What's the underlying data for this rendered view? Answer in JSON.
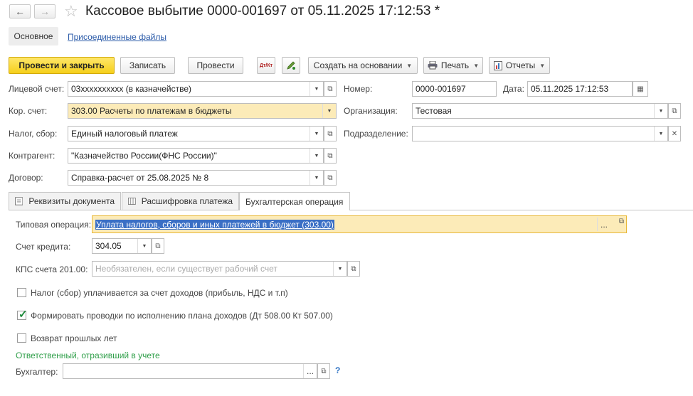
{
  "header": {
    "back_icon": "←",
    "forward_icon": "→",
    "star_icon": "☆",
    "title": "Кассовое выбытие 0000-001697 от 05.11.2025 17:12:53 *"
  },
  "nav_tabs": {
    "main": "Основное",
    "files": "Присоединенные файлы"
  },
  "toolbar": {
    "post_close": "Провести и закрыть",
    "save": "Записать",
    "post": "Провести",
    "dt_kt_icon": "Дт/Кт",
    "create_based": "Создать на основании",
    "print": "Печать",
    "reports": "Отчеты"
  },
  "form": {
    "account_label": "Лицевой счет:",
    "account_value": "03xxxxxxxxxx (в казначействе)",
    "number_label": "Номер:",
    "number_value": "0000-001697",
    "date_label": "Дата:",
    "date_value": "05.11.2025 17:12:53",
    "cor_label": "Кор. счет:",
    "cor_value": "303.00 Расчеты по платежам в бюджеты",
    "org_label": "Организация:",
    "org_value": "Тестовая",
    "tax_label": "Налог, сбор:",
    "tax_value": "Единый налоговый платеж",
    "dept_label": "Подразделение:",
    "dept_value": "",
    "contractor_label": "Контрагент:",
    "contractor_value": "\"Казначейство России(ФНС России)\"",
    "contract_label": "Договор:",
    "contract_value": "Справка-расчет от 25.08.2025 № 8"
  },
  "subtabs": {
    "details": "Реквизиты документа",
    "breakdown": "Расшифровка платежа",
    "accounting": "Бухгалтерская операция"
  },
  "accounting": {
    "op_label": "Типовая операция:",
    "op_value": "Уплата налогов, сборов и иных платежей в бюджет (303.00)",
    "credit_label": "Счет кредита:",
    "credit_value": "304.05",
    "kps_label": "КПС счета 201.00:",
    "kps_placeholder": "Необязателен, если существует рабочий счет",
    "chk1_label": "Налог (сбор) уплачивается за счет доходов (прибыль, НДС и т.п)",
    "chk1_checked": false,
    "chk2_label": "Формировать проводки по исполнению плана доходов (Дт 508.00 Кт 507.00)",
    "chk2_checked": true,
    "chk3_label": "Возврат прошлых лет",
    "chk3_checked": false,
    "responsible_header": "Ответственный, отразивший в учете",
    "accountant_label": "Бухгалтер:",
    "accountant_value": "",
    "help": "?"
  },
  "colors": {
    "primary": "#f5cf1b",
    "highlight": "#fcebb8",
    "link": "#2a5aa8",
    "green": "#2e9e48"
  }
}
